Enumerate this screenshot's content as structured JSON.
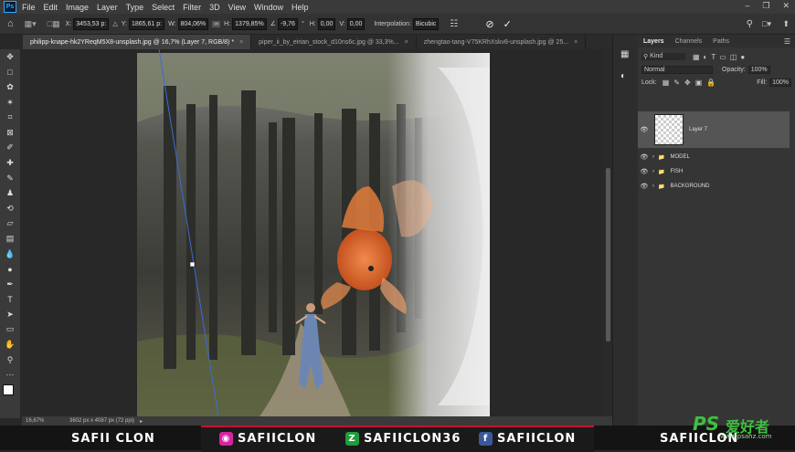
{
  "app": {
    "logo": "Ps"
  },
  "menu": [
    "File",
    "Edit",
    "Image",
    "Layer",
    "Type",
    "Select",
    "Filter",
    "3D",
    "View",
    "Window",
    "Help"
  ],
  "options": {
    "x_label": "X:",
    "x_value": "3453,53 p:",
    "y_label": "Y:",
    "y_value": "1865,61 p:",
    "w_label": "W:",
    "w_value": "804,06%",
    "h_label": "H:",
    "h_value": "1379,85%",
    "angle_value": "-9,76",
    "hskew_label": "H:",
    "hskew_value": "0,00",
    "vskew_label": "V:",
    "vskew_value": "0,00",
    "interp_label": "Interpolation:",
    "interp_value": "Bicubic"
  },
  "tabs": [
    {
      "label": "philipp-knape-hk2YReqM5X8-unsplash.jpg @ 16,7% (Layer 7, RGB/8) *",
      "active": true
    },
    {
      "label": "piper_ii_by_eirian_stock_d10ns6c.jpg @ 33,3%...",
      "active": false
    },
    {
      "label": "zhengtao-tang-V75KRhXskv8-unsplash.jpg @ 25...",
      "active": false
    }
  ],
  "status": {
    "zoom": "16,67%",
    "doc_info": "3602 px x 4087 px (72 ppi)"
  },
  "layers_panel": {
    "tabs": [
      "Layers",
      "Channels",
      "Paths"
    ],
    "kind_label": "Kind",
    "blend_mode": "Normal",
    "opacity_label": "Opacity:",
    "opacity_value": "100%",
    "lock_label": "Lock:",
    "fill_label": "Fill:",
    "fill_value": "100%",
    "layers": [
      {
        "name": "Layer 7"
      },
      {
        "name": "MODEL"
      },
      {
        "name": "FISH"
      },
      {
        "name": "BACKGROUND"
      }
    ]
  },
  "footer": {
    "left": "SAFII CLON",
    "instagram": "SAFIICLON",
    "zcool": "SAFIICLON36",
    "facebook": "SAFIICLON",
    "right": "SAFIICLON",
    "watermark_ps": "PS",
    "watermark_cn": "爱好者",
    "watermark_url": "www.psahz.com"
  },
  "colors": {
    "accent_red": "#c8102e",
    "ps_blue": "#31a8ff",
    "watermark_green": "#3fbf3f"
  }
}
